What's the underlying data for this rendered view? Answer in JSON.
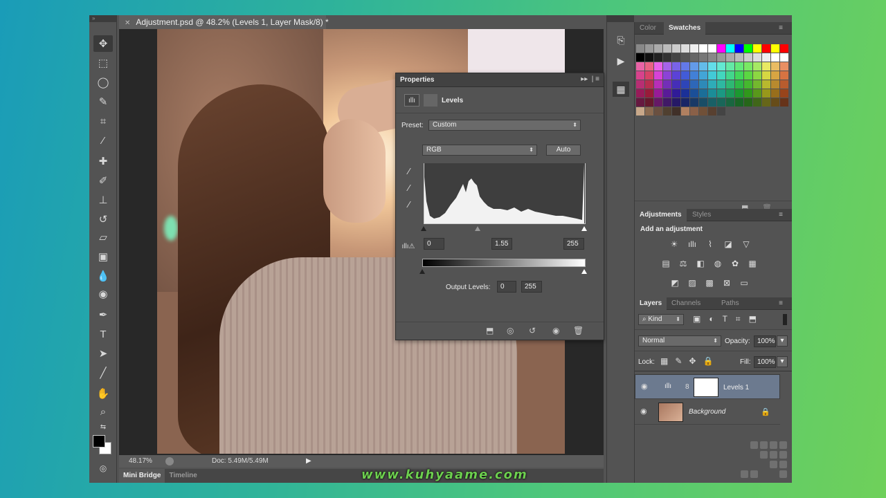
{
  "document": {
    "tab_title": "Adjustment.psd @ 48.2% (Levels 1, Layer Mask/8) *",
    "close_glyph": "✕",
    "zoom": "48.17%",
    "doc_size": "Doc: 5.49M/5.49M"
  },
  "bottom_tabs": [
    "Mini Bridge",
    "Timeline"
  ],
  "properties": {
    "title": "Properties",
    "panel_label": "Levels",
    "preset_label": "Preset:",
    "preset_value": "Custom",
    "channel_value": "RGB",
    "auto_label": "Auto",
    "input_black": "0",
    "input_gamma": "1.55",
    "input_white": "255",
    "output_label": "Output Levels:",
    "output_black": "0",
    "output_white": "255"
  },
  "swatches_panel": {
    "tabs": [
      "Color",
      "Swatches"
    ],
    "active": "Swatches"
  },
  "adjustments_panel": {
    "tabs": [
      "Adjustments",
      "Styles"
    ],
    "active": "Adjustments",
    "heading": "Add an adjustment"
  },
  "layers_panel": {
    "tabs": [
      "Layers",
      "Channels",
      "Paths"
    ],
    "active": "Layers",
    "kind_label": "Kind",
    "blend_mode": "Normal",
    "opacity_label": "Opacity:",
    "opacity_value": "100%",
    "lock_label": "Lock:",
    "fill_label": "Fill:",
    "fill_value": "100%",
    "layers": [
      {
        "name": "Levels 1",
        "selected": true
      },
      {
        "name": "Background",
        "selected": false
      }
    ]
  },
  "watermark": "www.kuhyaame.com",
  "colors": {
    "panel": "#535353",
    "panel_dark": "#424242",
    "selected_layer": "#6c7a8f",
    "watermark": "#6dcf4f"
  },
  "icons": [
    "move-icon",
    "marquee-icon",
    "lasso-icon",
    "quick-select-icon",
    "crop-icon",
    "eyedropper-icon",
    "healing-icon",
    "brush-icon",
    "stamp-icon",
    "history-brush-icon",
    "eraser-icon",
    "gradient-icon",
    "blur-icon",
    "dodge-icon",
    "pen-icon",
    "type-icon",
    "path-select-icon",
    "line-icon",
    "hand-icon",
    "zoom-icon"
  ]
}
